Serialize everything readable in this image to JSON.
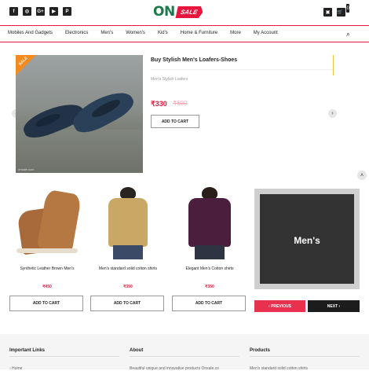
{
  "header": {
    "social_icons": [
      {
        "name": "facebook-icon",
        "glyph": "f"
      },
      {
        "name": "instagram-icon",
        "glyph": "◎"
      },
      {
        "name": "google-plus-icon",
        "glyph": "G+"
      },
      {
        "name": "youtube-icon",
        "glyph": "▶"
      },
      {
        "name": "pinterest-icon",
        "glyph": "P"
      }
    ],
    "logo_on": "ON",
    "logo_sale": "SALE",
    "bag_glyph": "▣",
    "cart_glyph": "🛒",
    "cart_count": "0"
  },
  "nav": {
    "items": [
      "Mobiles And Gadgets",
      "Electronics",
      "Men's",
      "Women's",
      "Kid's",
      "Home & Furniture",
      "More",
      "My Account"
    ],
    "search_glyph": "⌕"
  },
  "featured": {
    "sale_tag": "SALE",
    "title": "Buy Stylish Men's Loafers-Shoes",
    "subtitle": "Men's Stylish Loafers",
    "price": "₹330",
    "old_price": "₹600",
    "add_to_cart": "ADD TO CART",
    "prev_arrow": "‹",
    "next_arrow": "›",
    "scroll_top": "˄",
    "image_caption": "onsale.com"
  },
  "products": [
    {
      "title": "Synthetic Leather Brown Men's",
      "price": "₹450",
      "button": "ADD TO CART"
    },
    {
      "title": "Men's standard solid cotton shirts",
      "price": "₹350",
      "button": "ADD TO CART"
    },
    {
      "title": "Elegant Men's Cotton shirts",
      "price": "₹350",
      "button": "ADD TO CART"
    }
  ],
  "banner": {
    "label": "Men's",
    "prev_label": "‹ PREVIOUS",
    "next_label": "NEXT ›"
  },
  "footer": {
    "columns": [
      {
        "heading": "Important Links",
        "text": "› Home"
      },
      {
        "heading": "About",
        "text": "Beautiful unique and innovative products Onsale.co"
      },
      {
        "heading": "Products",
        "text": "Men's standard solid cotton shirts"
      }
    ]
  },
  "colors": {
    "accent": "#e8163c",
    "brand_green": "#1a7a4a",
    "sale_orange": "#f58a1f"
  }
}
